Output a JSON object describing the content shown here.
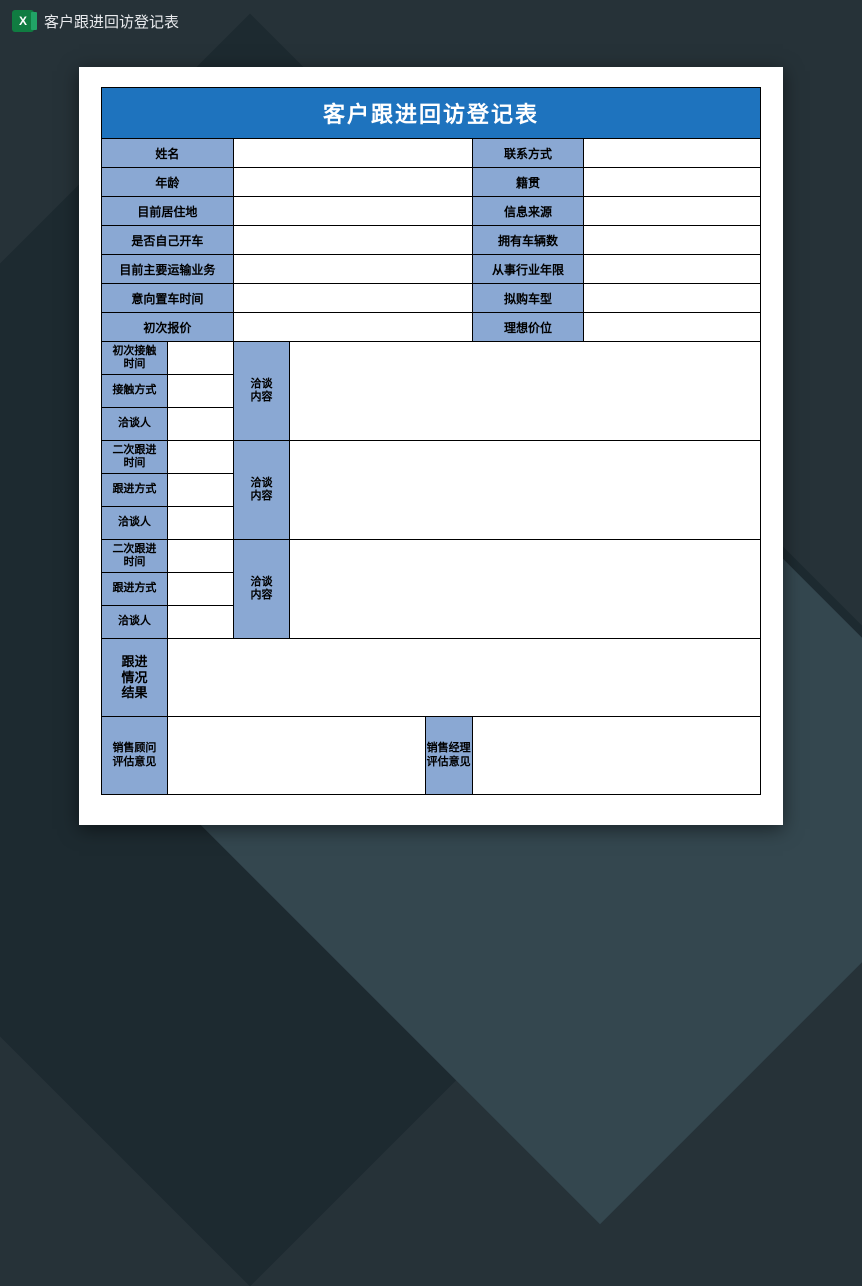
{
  "app": {
    "title": "客户跟进回访登记表"
  },
  "form": {
    "title": "客户跟进回访登记表",
    "rows": {
      "name_label": "姓名",
      "name_value": "",
      "contact_label": "联系方式",
      "contact_value": "",
      "age_label": "年龄",
      "age_value": "",
      "origin_label": "籍贯",
      "origin_value": "",
      "residence_label": "目前居住地",
      "residence_value": "",
      "source_label": "信息来源",
      "source_value": "",
      "self_drive_label": "是否自己开车",
      "self_drive_value": "",
      "vehicle_count_label": "拥有车辆数",
      "vehicle_count_value": "",
      "transport_biz_label": "目前主要运输业务",
      "transport_biz_value": "",
      "industry_years_label": "从事行业年限",
      "industry_years_value": "",
      "intent_time_label": "意向置车时间",
      "intent_time_value": "",
      "intent_model_label": "拟购车型",
      "intent_model_value": "",
      "first_quote_label": "初次报价",
      "first_quote_value": "",
      "ideal_price_label": "理想价位",
      "ideal_price_value": ""
    },
    "contact1": {
      "time_label": "初次接触\n时间",
      "time_value": "",
      "method_label": "接触方式",
      "method_value": "",
      "person_label": "洽谈人",
      "person_value": "",
      "content_label": "洽谈\n内容",
      "content_value": ""
    },
    "contact2": {
      "time_label": "二次跟进\n时间",
      "time_value": "",
      "method_label": "跟进方式",
      "method_value": "",
      "person_label": "洽谈人",
      "person_value": "",
      "content_label": "洽谈\n内容",
      "content_value": ""
    },
    "contact3": {
      "time_label": "二次跟进\n时间",
      "time_value": "",
      "method_label": "跟进方式",
      "method_value": "",
      "person_label": "洽谈人",
      "person_value": "",
      "content_label": "洽谈\n内容",
      "content_value": ""
    },
    "result_label": "跟进\n情况\n结果",
    "result_value": "",
    "advisor_label": "销售顾问\n评估意见",
    "advisor_value": "",
    "manager_label": "销售经理\n评估意见",
    "manager_value": ""
  }
}
